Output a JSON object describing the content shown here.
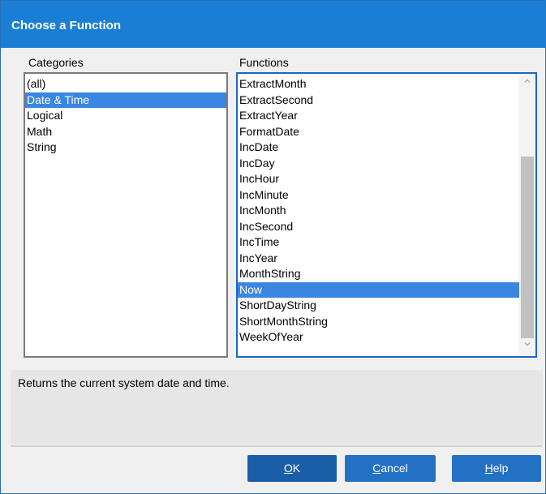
{
  "dialog": {
    "title": "Choose a Function"
  },
  "categories": {
    "label": "Categories",
    "items": [
      "(all)",
      "Date & Time",
      "Logical",
      "Math",
      "String"
    ],
    "selected_index": 1
  },
  "functions": {
    "label": "Functions",
    "items": [
      "ExtractMonth",
      "ExtractSecond",
      "ExtractYear",
      "FormatDate",
      "IncDate",
      "IncDay",
      "IncHour",
      "IncMinute",
      "IncMonth",
      "IncSecond",
      "IncTime",
      "IncYear",
      "MonthString",
      "Now",
      "ShortDayString",
      "ShortMonthString",
      "WeekOfYear"
    ],
    "selected_index": 13
  },
  "description": {
    "text": "Returns the current system date and time."
  },
  "buttons": {
    "ok": {
      "mnemonic": "O",
      "rest": "K"
    },
    "cancel": {
      "mnemonic": "C",
      "rest": "ancel"
    },
    "help": {
      "mnemonic": "H",
      "rest": "elp"
    }
  },
  "icons": {
    "scroll_up": "chevron-up-icon",
    "scroll_down": "chevron-down-icon"
  },
  "colors": {
    "titlebar": "#1a7fd4",
    "selection": "#3a86e0",
    "button": "#2271c4"
  }
}
